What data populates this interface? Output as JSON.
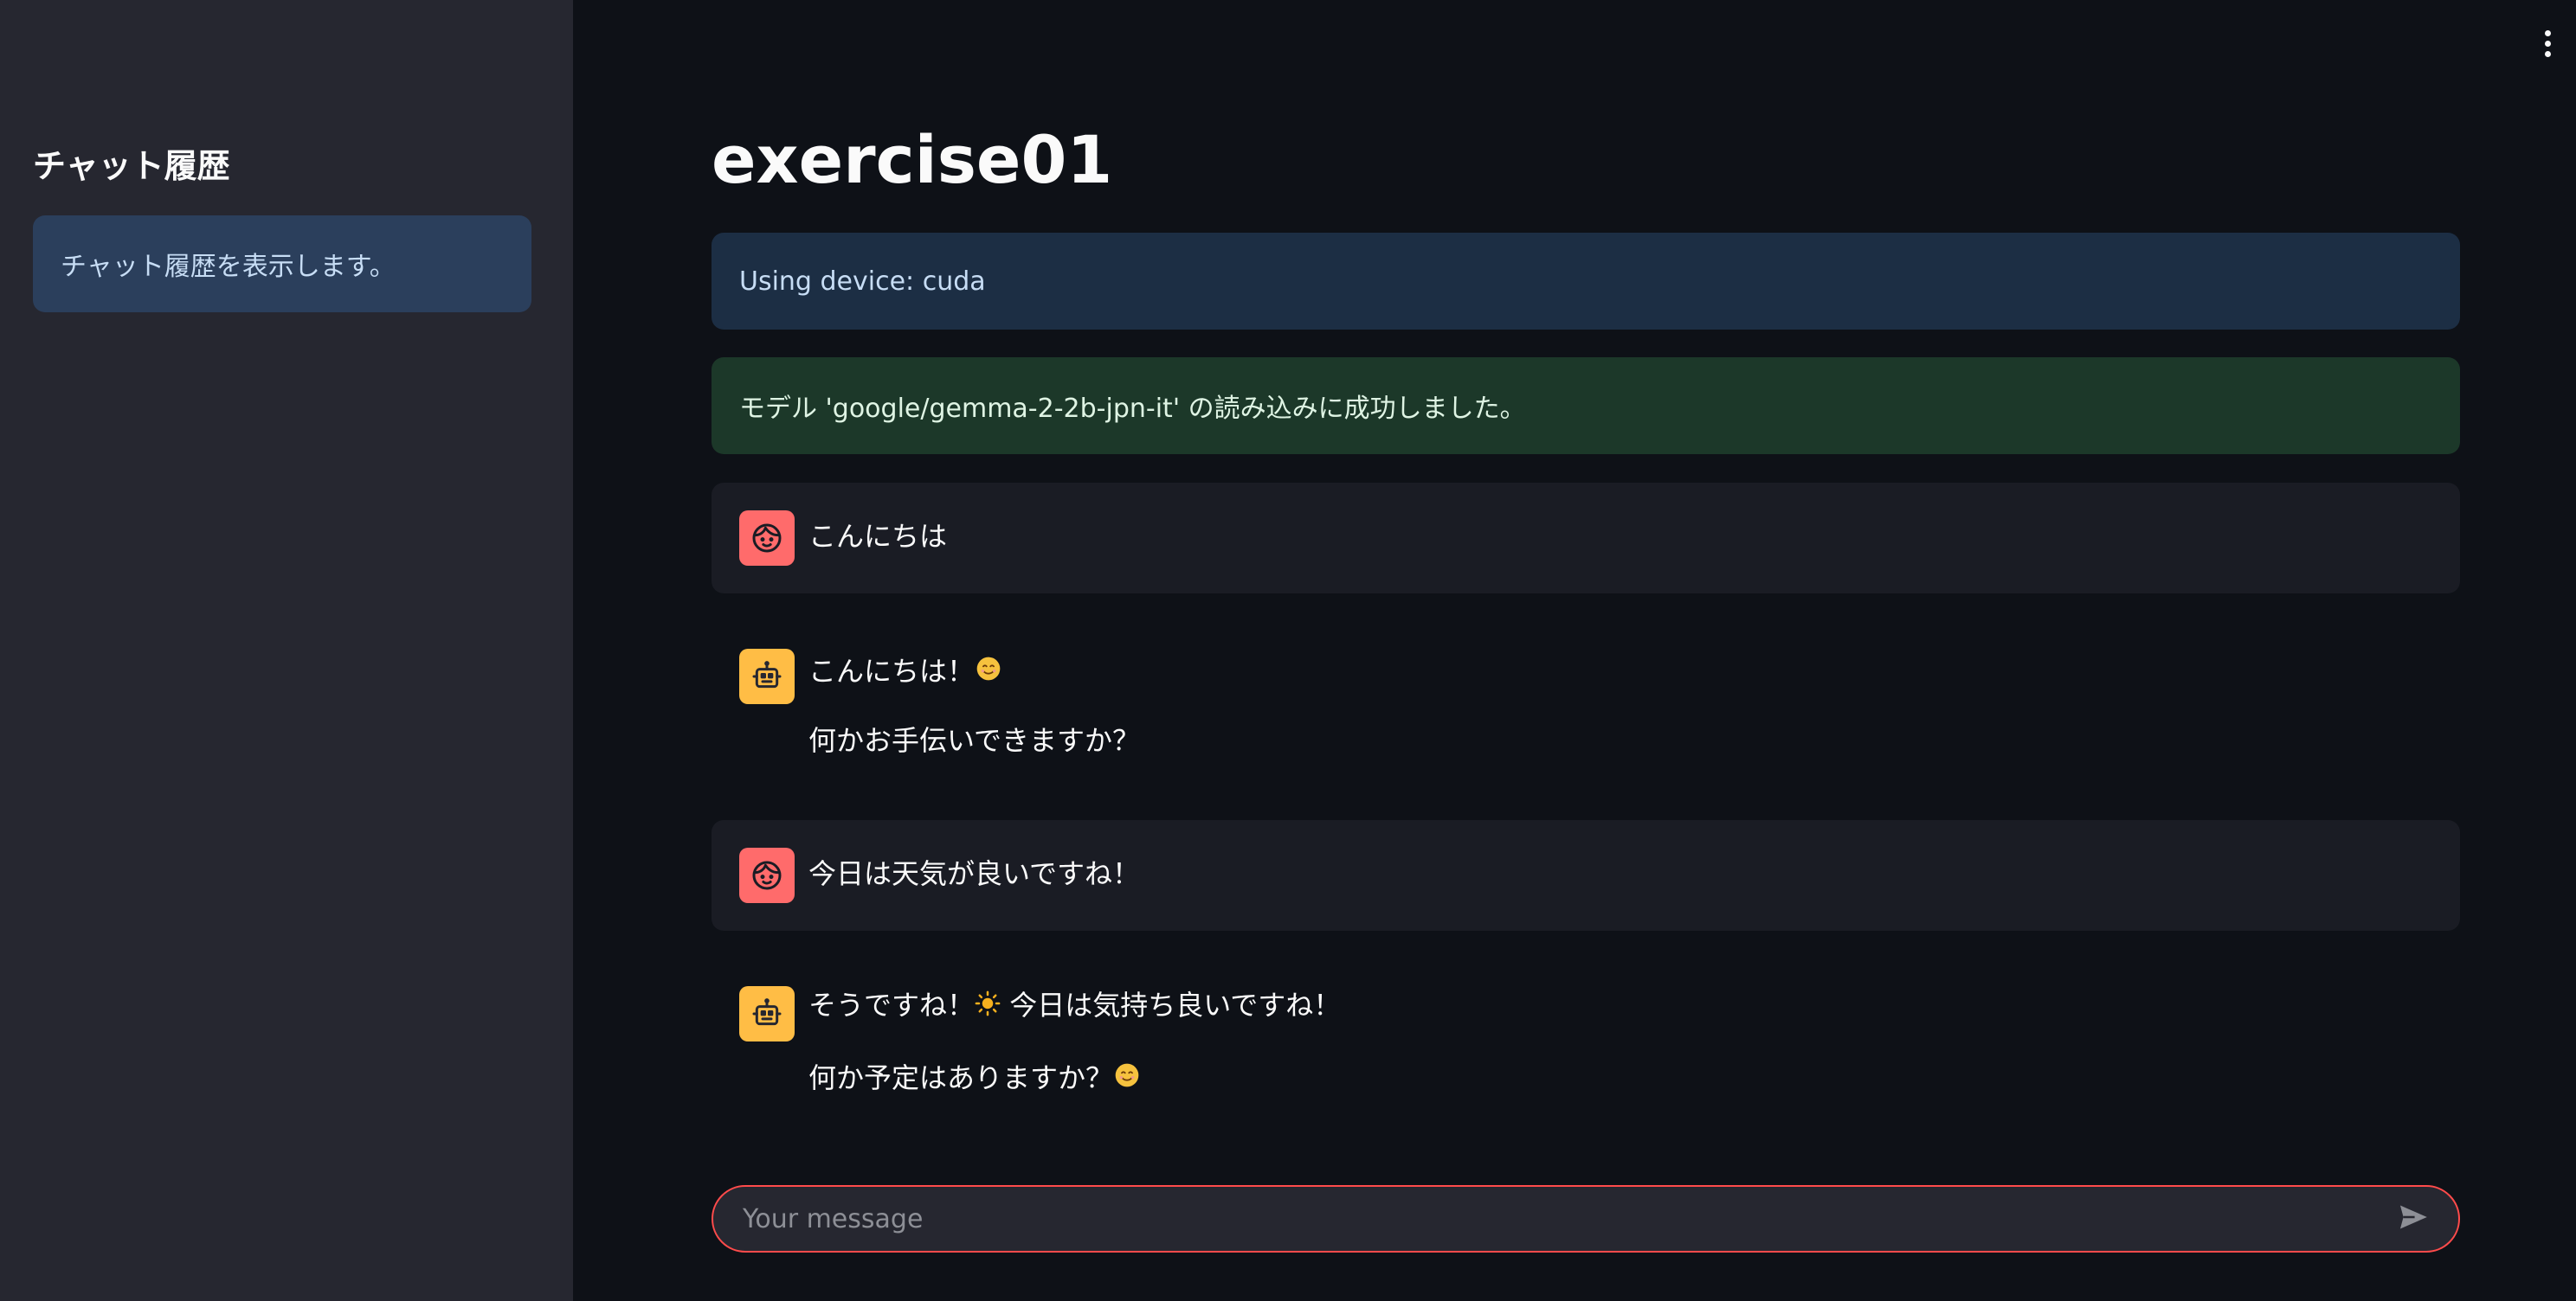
{
  "sidebar": {
    "title": "チャット履歴",
    "info": "チャット履歴を表示します。"
  },
  "main": {
    "title": "exercise01",
    "alerts": {
      "info": "Using device: cuda",
      "success": "モデル 'google/gemma-2-2b-jpn-it' の読み込みに成功しました。"
    },
    "messages": [
      {
        "role": "user",
        "lines": [
          "こんにちは"
        ]
      },
      {
        "role": "assistant",
        "lines": [
          "こんにちは！",
          "何かお手伝いできますか？"
        ]
      },
      {
        "role": "user",
        "lines": [
          "今日は天気が良いですね！"
        ]
      },
      {
        "role": "assistant",
        "lines": [
          "そうですね！",
          "今日は気持ち良いですね！",
          "何か予定はありますか？"
        ]
      }
    ]
  },
  "chat_input": {
    "placeholder": "Your message"
  },
  "icons": {
    "user_avatar": "smiley-face-icon",
    "assistant_avatar": "robot-icon",
    "send": "send-arrow-icon",
    "menu": "vertical-dots-icon",
    "emoji_smile": "smiling-face-emoji",
    "emoji_sun": "sun-emoji"
  },
  "colors": {
    "background": "#0e1117",
    "sidebar": "#262730",
    "accent": "#ff4b4b",
    "user_avatar": "#ff6b6b",
    "assistant_avatar": "#ffbd45"
  }
}
